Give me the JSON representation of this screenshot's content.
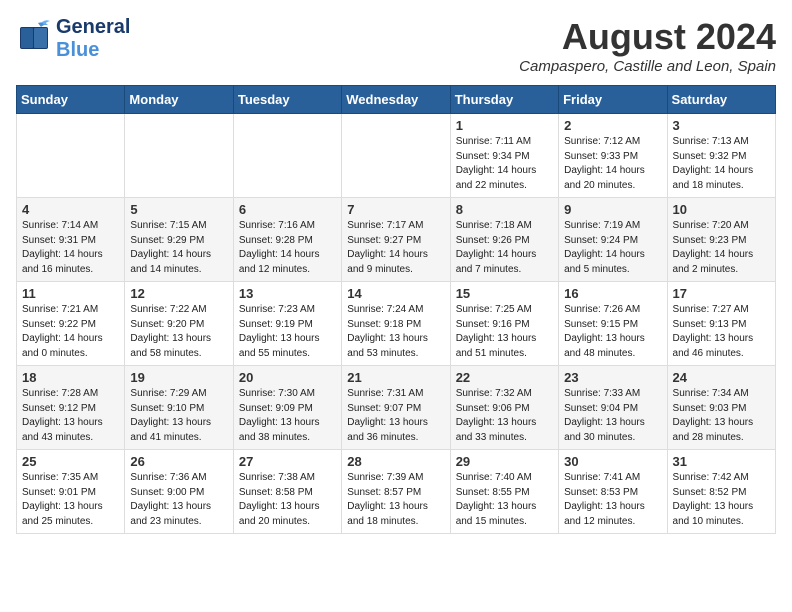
{
  "header": {
    "logo_general": "General",
    "logo_blue": "Blue",
    "main_title": "August 2024",
    "subtitle": "Campaspero, Castille and Leon, Spain"
  },
  "days_of_week": [
    "Sunday",
    "Monday",
    "Tuesday",
    "Wednesday",
    "Thursday",
    "Friday",
    "Saturday"
  ],
  "weeks": [
    {
      "row_class": "row-odd",
      "cells": [
        {
          "day": "",
          "content": ""
        },
        {
          "day": "",
          "content": ""
        },
        {
          "day": "",
          "content": ""
        },
        {
          "day": "",
          "content": ""
        },
        {
          "day": "1",
          "content": "Sunrise: 7:11 AM\nSunset: 9:34 PM\nDaylight: 14 hours\nand 22 minutes."
        },
        {
          "day": "2",
          "content": "Sunrise: 7:12 AM\nSunset: 9:33 PM\nDaylight: 14 hours\nand 20 minutes."
        },
        {
          "day": "3",
          "content": "Sunrise: 7:13 AM\nSunset: 9:32 PM\nDaylight: 14 hours\nand 18 minutes."
        }
      ]
    },
    {
      "row_class": "row-even",
      "cells": [
        {
          "day": "4",
          "content": "Sunrise: 7:14 AM\nSunset: 9:31 PM\nDaylight: 14 hours\nand 16 minutes."
        },
        {
          "day": "5",
          "content": "Sunrise: 7:15 AM\nSunset: 9:29 PM\nDaylight: 14 hours\nand 14 minutes."
        },
        {
          "day": "6",
          "content": "Sunrise: 7:16 AM\nSunset: 9:28 PM\nDaylight: 14 hours\nand 12 minutes."
        },
        {
          "day": "7",
          "content": "Sunrise: 7:17 AM\nSunset: 9:27 PM\nDaylight: 14 hours\nand 9 minutes."
        },
        {
          "day": "8",
          "content": "Sunrise: 7:18 AM\nSunset: 9:26 PM\nDaylight: 14 hours\nand 7 minutes."
        },
        {
          "day": "9",
          "content": "Sunrise: 7:19 AM\nSunset: 9:24 PM\nDaylight: 14 hours\nand 5 minutes."
        },
        {
          "day": "10",
          "content": "Sunrise: 7:20 AM\nSunset: 9:23 PM\nDaylight: 14 hours\nand 2 minutes."
        }
      ]
    },
    {
      "row_class": "row-odd",
      "cells": [
        {
          "day": "11",
          "content": "Sunrise: 7:21 AM\nSunset: 9:22 PM\nDaylight: 14 hours\nand 0 minutes."
        },
        {
          "day": "12",
          "content": "Sunrise: 7:22 AM\nSunset: 9:20 PM\nDaylight: 13 hours\nand 58 minutes."
        },
        {
          "day": "13",
          "content": "Sunrise: 7:23 AM\nSunset: 9:19 PM\nDaylight: 13 hours\nand 55 minutes."
        },
        {
          "day": "14",
          "content": "Sunrise: 7:24 AM\nSunset: 9:18 PM\nDaylight: 13 hours\nand 53 minutes."
        },
        {
          "day": "15",
          "content": "Sunrise: 7:25 AM\nSunset: 9:16 PM\nDaylight: 13 hours\nand 51 minutes."
        },
        {
          "day": "16",
          "content": "Sunrise: 7:26 AM\nSunset: 9:15 PM\nDaylight: 13 hours\nand 48 minutes."
        },
        {
          "day": "17",
          "content": "Sunrise: 7:27 AM\nSunset: 9:13 PM\nDaylight: 13 hours\nand 46 minutes."
        }
      ]
    },
    {
      "row_class": "row-even",
      "cells": [
        {
          "day": "18",
          "content": "Sunrise: 7:28 AM\nSunset: 9:12 PM\nDaylight: 13 hours\nand 43 minutes."
        },
        {
          "day": "19",
          "content": "Sunrise: 7:29 AM\nSunset: 9:10 PM\nDaylight: 13 hours\nand 41 minutes."
        },
        {
          "day": "20",
          "content": "Sunrise: 7:30 AM\nSunset: 9:09 PM\nDaylight: 13 hours\nand 38 minutes."
        },
        {
          "day": "21",
          "content": "Sunrise: 7:31 AM\nSunset: 9:07 PM\nDaylight: 13 hours\nand 36 minutes."
        },
        {
          "day": "22",
          "content": "Sunrise: 7:32 AM\nSunset: 9:06 PM\nDaylight: 13 hours\nand 33 minutes."
        },
        {
          "day": "23",
          "content": "Sunrise: 7:33 AM\nSunset: 9:04 PM\nDaylight: 13 hours\nand 30 minutes."
        },
        {
          "day": "24",
          "content": "Sunrise: 7:34 AM\nSunset: 9:03 PM\nDaylight: 13 hours\nand 28 minutes."
        }
      ]
    },
    {
      "row_class": "row-odd",
      "cells": [
        {
          "day": "25",
          "content": "Sunrise: 7:35 AM\nSunset: 9:01 PM\nDaylight: 13 hours\nand 25 minutes."
        },
        {
          "day": "26",
          "content": "Sunrise: 7:36 AM\nSunset: 9:00 PM\nDaylight: 13 hours\nand 23 minutes."
        },
        {
          "day": "27",
          "content": "Sunrise: 7:38 AM\nSunset: 8:58 PM\nDaylight: 13 hours\nand 20 minutes."
        },
        {
          "day": "28",
          "content": "Sunrise: 7:39 AM\nSunset: 8:57 PM\nDaylight: 13 hours\nand 18 minutes."
        },
        {
          "day": "29",
          "content": "Sunrise: 7:40 AM\nSunset: 8:55 PM\nDaylight: 13 hours\nand 15 minutes."
        },
        {
          "day": "30",
          "content": "Sunrise: 7:41 AM\nSunset: 8:53 PM\nDaylight: 13 hours\nand 12 minutes."
        },
        {
          "day": "31",
          "content": "Sunrise: 7:42 AM\nSunset: 8:52 PM\nDaylight: 13 hours\nand 10 minutes."
        }
      ]
    }
  ]
}
